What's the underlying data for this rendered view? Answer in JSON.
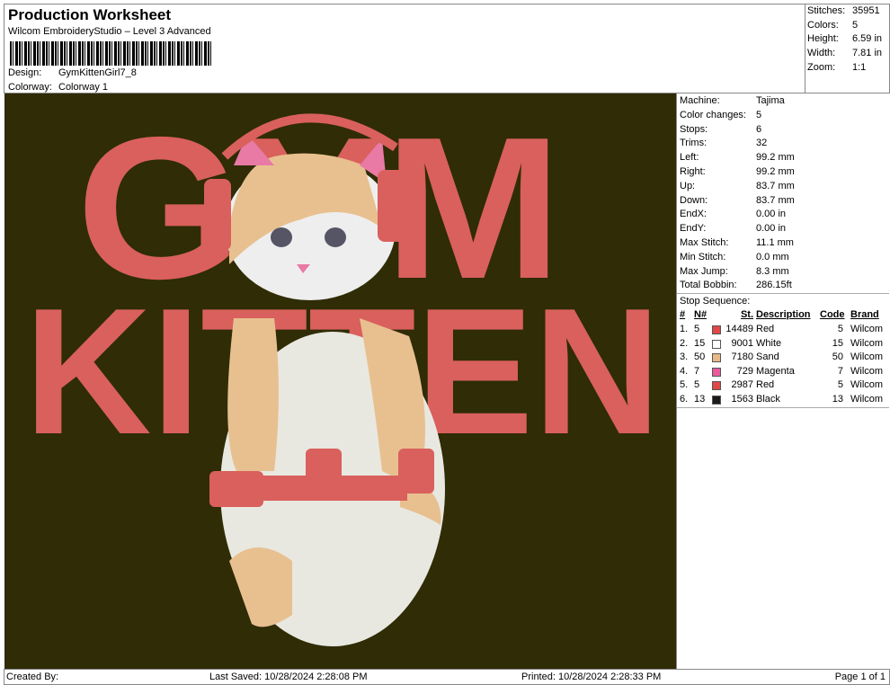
{
  "header": {
    "title": "Production Worksheet",
    "subtitle": "Wilcom EmbroideryStudio – Level 3 Advanced",
    "design_label": "Design:",
    "design_value": "GymKittenGirl7_8",
    "colorway_label": "Colorway:",
    "colorway_value": "Colorway 1"
  },
  "summary": [
    {
      "label": "Stitches:",
      "value": "35951"
    },
    {
      "label": "Colors:",
      "value": "5"
    },
    {
      "label": "Height:",
      "value": "6.59 in"
    },
    {
      "label": "Width:",
      "value": "7.81 in"
    },
    {
      "label": "Zoom:",
      "value": "1:1"
    }
  ],
  "design": {
    "line1": "GYM",
    "line2": "KITTEN",
    "background": "#2f2c06",
    "text_color": "#d9605c"
  },
  "details": [
    {
      "label": "Machine:",
      "value": "Tajima"
    },
    {
      "label": "Color changes:",
      "value": "5"
    },
    {
      "label": "Stops:",
      "value": "6"
    },
    {
      "label": "Trims:",
      "value": "32"
    },
    {
      "label": "Left:",
      "value": "99.2 mm"
    },
    {
      "label": "Right:",
      "value": "99.2 mm"
    },
    {
      "label": "Up:",
      "value": "83.7 mm"
    },
    {
      "label": "Down:",
      "value": "83.7 mm"
    },
    {
      "label": "EndX:",
      "value": "0.00 in"
    },
    {
      "label": "EndY:",
      "value": "0.00 in"
    },
    {
      "label": "Max Stitch:",
      "value": "11.1 mm"
    },
    {
      "label": "Min Stitch:",
      "value": "0.0 mm"
    },
    {
      "label": "Max Jump:",
      "value": "8.3 mm"
    },
    {
      "label": "Total Bobbin:",
      "value": "286.15ft"
    }
  ],
  "stop_sequence": {
    "title": "Stop Sequence:",
    "headers": {
      "num": "#",
      "n": "N#",
      "st": "St.",
      "desc": "Description",
      "code": "Code",
      "brand": "Brand"
    },
    "rows": [
      {
        "num": "1.",
        "n": "5",
        "color": "#e04848",
        "st": "14489",
        "desc": "Red",
        "code": "5",
        "brand": "Wilcom"
      },
      {
        "num": "2.",
        "n": "15",
        "color": "#ffffff",
        "st": "9001",
        "desc": "White",
        "code": "15",
        "brand": "Wilcom"
      },
      {
        "num": "3.",
        "n": "50",
        "color": "#e8b888",
        "st": "7180",
        "desc": "Sand",
        "code": "50",
        "brand": "Wilcom"
      },
      {
        "num": "4.",
        "n": "7",
        "color": "#e85a9a",
        "st": "729",
        "desc": "Magenta",
        "code": "7",
        "brand": "Wilcom"
      },
      {
        "num": "5.",
        "n": "5",
        "color": "#e04848",
        "st": "2987",
        "desc": "Red",
        "code": "5",
        "brand": "Wilcom"
      },
      {
        "num": "6.",
        "n": "13",
        "color": "#1a1a1a",
        "st": "1563",
        "desc": "Black",
        "code": "13",
        "brand": "Wilcom"
      }
    ]
  },
  "footer": {
    "created_by": "Created By:",
    "last_saved": "Last Saved: 10/28/2024 2:28:08 PM",
    "printed": "Printed: 10/28/2024 2:28:33 PM",
    "page": "Page 1 of 1"
  }
}
